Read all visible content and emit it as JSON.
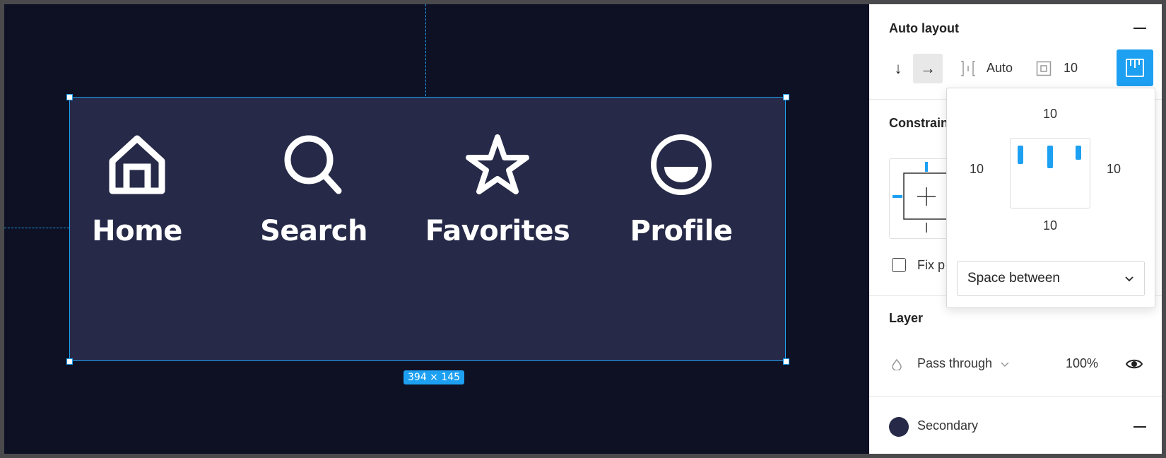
{
  "canvas": {
    "nav_items": [
      {
        "label": "Home",
        "icon": "home-icon"
      },
      {
        "label": "Search",
        "icon": "search-icon"
      },
      {
        "label": "Favorites",
        "icon": "star-icon"
      },
      {
        "label": "Profile",
        "icon": "profile-icon"
      }
    ],
    "size_badge": "394 × 145"
  },
  "panel": {
    "auto_layout": {
      "title": "Auto layout",
      "spacing_value": "Auto",
      "padding_value": "10"
    },
    "constraints": {
      "title": "Constrain",
      "fix_position_label": "Fix p"
    },
    "padding_popover": {
      "top": "10",
      "left": "10",
      "right": "10",
      "bottom": "10",
      "distribution": "Space between"
    },
    "layer": {
      "title": "Layer",
      "blend_mode": "Pass through",
      "opacity": "100%"
    },
    "fill": {
      "style_name": "Secondary",
      "color": "#262a48"
    }
  },
  "colors": {
    "accent": "#1da0f2",
    "canvas_bg": "#0e1024",
    "frame_bg": "#262a48"
  }
}
